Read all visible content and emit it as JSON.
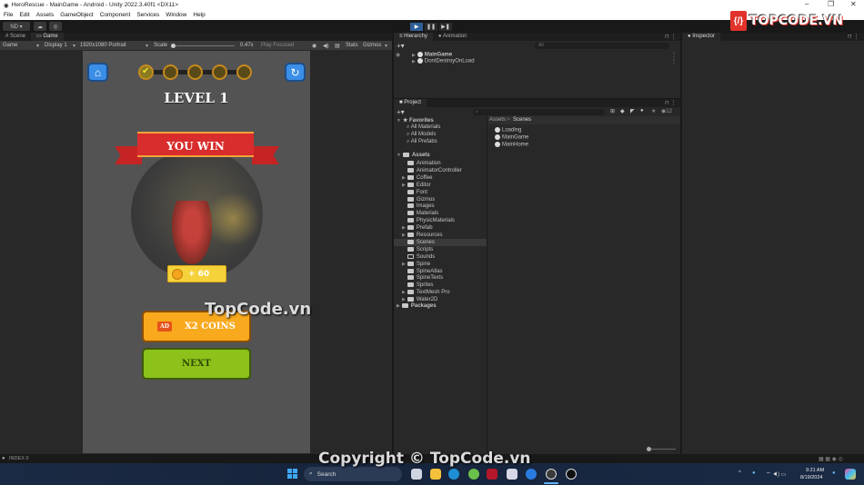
{
  "window": {
    "title": "HeroRescue - MainGame - Android - Unity 2022.3.40f1 <DX11>",
    "minimize": "–",
    "maximize": "❐",
    "close": "✕"
  },
  "menu": [
    "File",
    "Edit",
    "Assets",
    "GameObject",
    "Component",
    "Services",
    "Window",
    "Help"
  ],
  "toolbar": {
    "account": "ND ▾",
    "cloud": "☁",
    "collab": "◎",
    "play": "▶",
    "pause": "❚❚",
    "step": "▶❚"
  },
  "game_panel": {
    "tabs": [
      "Scene",
      "Game"
    ],
    "active_tab": "Game",
    "view_select": "Game",
    "display_select": "Display 1",
    "resolution_select": "1920x1080 Portrait",
    "scale_label": "Scale",
    "scale_value": "0.47x",
    "play_mode": "Play Focused",
    "stats": "Stats",
    "gizmos": "Gizmos"
  },
  "game": {
    "level_title": "LEVEL 1",
    "banner": "YOU WIN",
    "reward": "+ 60",
    "double_button": "X2 COINS",
    "ad_label": "AD",
    "next_button": "NEXT",
    "progress_total": 5,
    "progress_completed": 1
  },
  "hierarchy": {
    "tabs": [
      "Hierarchy",
      "Animation"
    ],
    "search_placeholder": "All",
    "items": [
      "MainGame",
      "DontDestroyOnLoad"
    ]
  },
  "inspector": {
    "tab": "Inspector"
  },
  "project": {
    "tab": "Project",
    "breadcrumb": [
      "Assets",
      "Scenes"
    ],
    "hidden_count": "12",
    "favorites_label": "Favorites",
    "favorites": [
      "All Materials",
      "All Models",
      "All Prefabs"
    ],
    "assets_label": "Assets",
    "folders": [
      {
        "name": "Animation",
        "expand": false
      },
      {
        "name": "AnimatorController",
        "expand": false
      },
      {
        "name": "Coffee",
        "expand": true
      },
      {
        "name": "Editor",
        "expand": true
      },
      {
        "name": "Font",
        "expand": false
      },
      {
        "name": "Gizmos",
        "expand": false
      },
      {
        "name": "Images",
        "expand": false
      },
      {
        "name": "Materials",
        "expand": false
      },
      {
        "name": "PhysicMaterials",
        "expand": false
      },
      {
        "name": "Prefab",
        "expand": true
      },
      {
        "name": "Resources",
        "expand": true
      },
      {
        "name": "Scenes",
        "expand": false
      },
      {
        "name": "Scripts",
        "expand": false
      },
      {
        "name": "Sounds",
        "expand": false
      },
      {
        "name": "Spine",
        "expand": true
      },
      {
        "name": "SpineAtlas",
        "expand": false
      },
      {
        "name": "SpineTexts",
        "expand": false
      },
      {
        "name": "Sprites",
        "expand": false
      },
      {
        "name": "TextMesh Pro",
        "expand": true
      },
      {
        "name": "Water2D",
        "expand": true
      }
    ],
    "selected_folder": "Scenes",
    "packages_label": "Packages",
    "scenes": [
      "Loading",
      "MainGame",
      "MainHome"
    ]
  },
  "status": {
    "text": "INDEX 0"
  },
  "taskbar": {
    "search": "Search",
    "time": "9:21 AM",
    "date": "8/19/2024"
  },
  "watermarks": {
    "logo": "TOPCODE.VN",
    "center": "TopCode.vn",
    "bottom": "Copyright © TopCode.vn"
  },
  "colors": {
    "play_active": "#2f5f96",
    "ribbon": "#d92c2c",
    "coins_button": "#f5a623",
    "next_button": "#8cc21a",
    "home_button": "#3b8ee6"
  }
}
